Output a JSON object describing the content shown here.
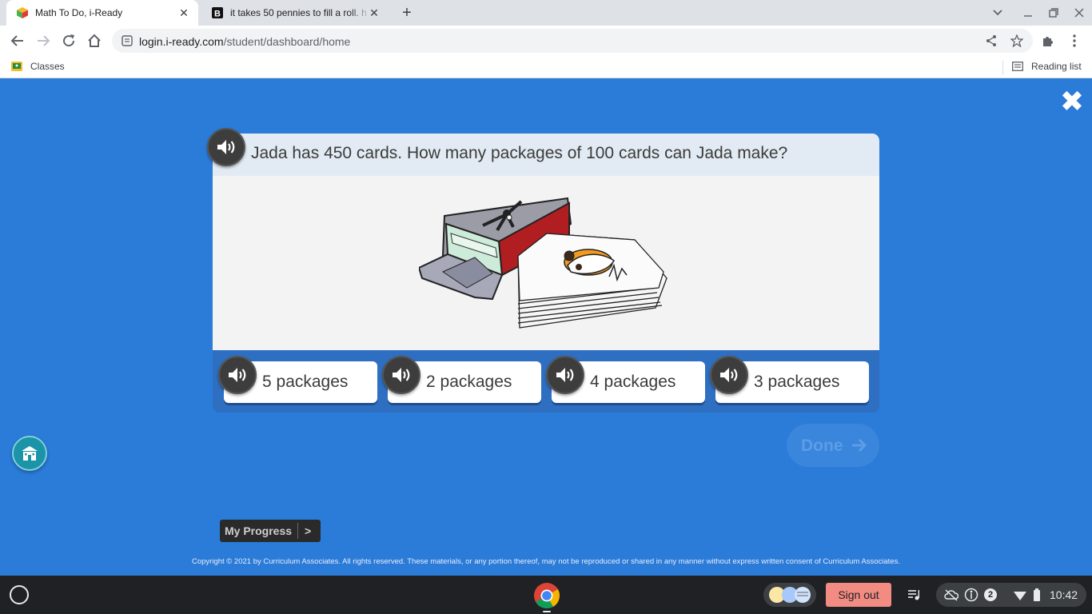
{
  "browser": {
    "tabs": [
      {
        "title": "Math To Do, i-Ready",
        "active": true
      },
      {
        "title": "it takes 50 pennies to fill a roll. h",
        "active": false
      }
    ],
    "url_domain": "login.i-ready.com",
    "url_path": "/student/dashboard/home",
    "bookmarks": [
      {
        "label": "Classes"
      }
    ],
    "reading_list_label": "Reading list"
  },
  "lesson": {
    "question": "Jada has 450 cards. How many packages of 100 cards can Jada make?",
    "answers": [
      {
        "label": "5 packages"
      },
      {
        "label": "2 packages"
      },
      {
        "label": "4 packages"
      },
      {
        "label": "3 packages"
      }
    ],
    "done_label": "Done",
    "my_progress_label": "My Progress",
    "my_progress_arrow": ">",
    "copyright": "Copyright © 2021 by Curriculum Associates. All rights reserved. These materials, or any portion thereof, may not be reproduced or shared in any manner without express written consent of Curriculum Associates."
  },
  "shelf": {
    "sign_out_label": "Sign out",
    "notification_count": "2",
    "time": "10:42"
  },
  "colors": {
    "app_background": "#2b7bd9",
    "question_header": "#e2ebf3",
    "answers_bar": "#2e6fc2",
    "sign_out": "#f28b82"
  }
}
